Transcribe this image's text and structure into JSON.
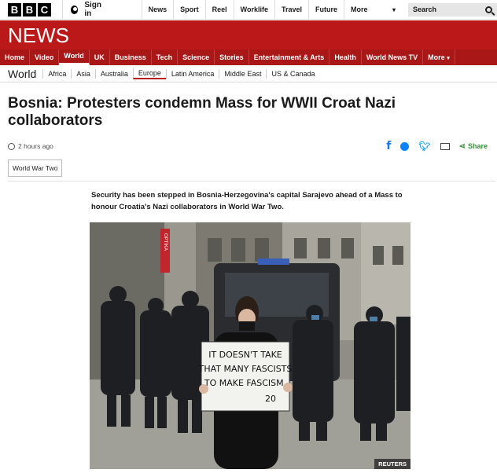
{
  "header": {
    "logo_letters": [
      "B",
      "B",
      "C"
    ],
    "signin_label": "Sign in",
    "nav_items": [
      "News",
      "Sport",
      "Reel",
      "Worklife",
      "Travel",
      "Future",
      "More"
    ],
    "search_placeholder": "Search"
  },
  "brand": {
    "section_title": "NEWS"
  },
  "red_nav": {
    "items": [
      "Home",
      "Video",
      "World",
      "UK",
      "Business",
      "Tech",
      "Science",
      "Stories",
      "Entertainment & Arts",
      "Health",
      "World News TV",
      "More"
    ],
    "active": "World"
  },
  "sub_nav": {
    "title": "World",
    "items": [
      "Africa",
      "Asia",
      "Australia",
      "Europe",
      "Latin America",
      "Middle East",
      "US & Canada"
    ],
    "selected": "Europe"
  },
  "article": {
    "headline": "Bosnia: Protesters condemn Mass for WWII Croat Nazi collaborators",
    "timestamp": "2 hours ago",
    "share_label": "Share",
    "tag": "World War Two",
    "intro": "Security has been stepped in Bosnia-Herzegovina's capital Sarajevo ahead of a Mass to honour Croatia's Nazi collaborators in World War Two.",
    "image_credit": "REUTERS",
    "sign_text": [
      "IT DOESN'T TAKE",
      "THAT MANY FASCISTS",
      "TO MAKE FASCISM.",
      "20"
    ],
    "storefront_sign": "OPTIKA"
  },
  "colors": {
    "brand_red": "#bb1919",
    "nav_red": "#a91717",
    "share_green": "#3a8d3a"
  }
}
